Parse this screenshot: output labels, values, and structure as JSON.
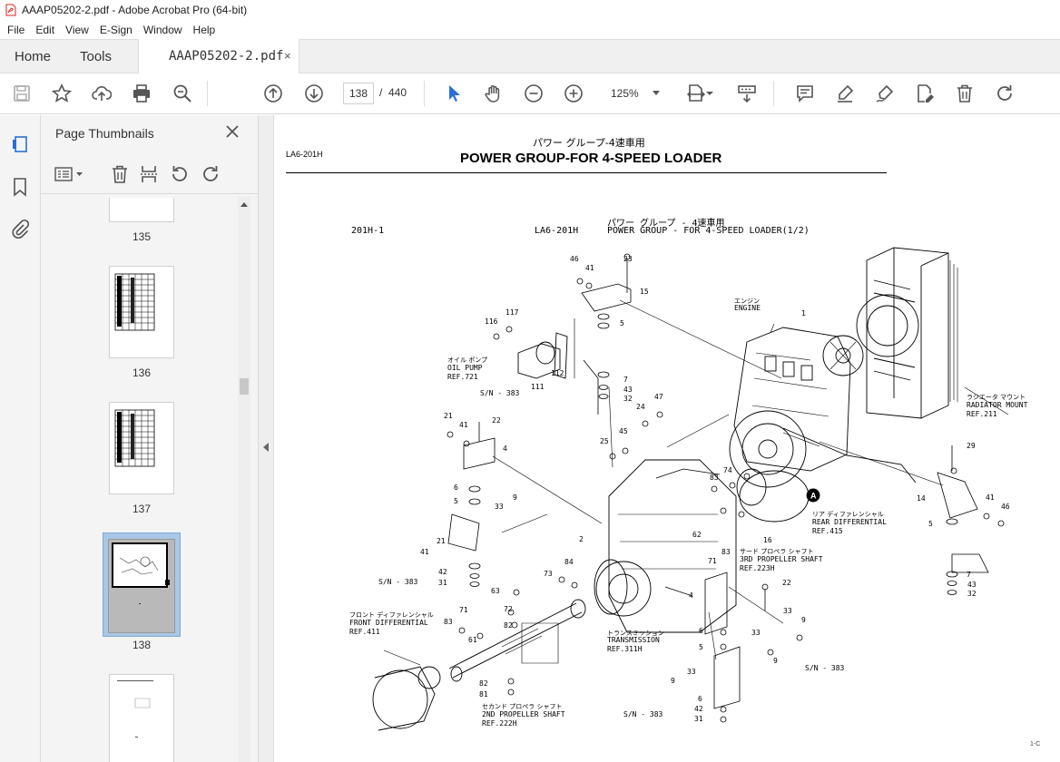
{
  "window": {
    "title": "AAAP05202-2.pdf - Adobe Acrobat Pro (64-bit)"
  },
  "menu": [
    "File",
    "Edit",
    "View",
    "E-Sign",
    "Window",
    "Help"
  ],
  "tabs": {
    "home": "Home",
    "tools": "Tools",
    "document": "AAAP05202-2.pdf",
    "close_glyph": "×"
  },
  "toolbar": {
    "current_page": "138",
    "page_separator": "/",
    "total_pages": "440",
    "zoom": "125%"
  },
  "thumbnails_panel": {
    "title": "Page Thumbnails",
    "pages": [
      {
        "label": "135"
      },
      {
        "label": "136"
      },
      {
        "label": "137"
      },
      {
        "label": "138",
        "selected": true
      }
    ]
  },
  "document": {
    "tag": "LA6-201H",
    "title_jp": "パワー グループ-4速車用",
    "title_en": "POWER GROUP-FOR 4-SPEED LOADER",
    "drawing_ref": "201H-1",
    "drawing_code": "LA6-201H",
    "drawing_title_jp": "パワー グループ - 4速車用",
    "drawing_title_en": "POWER GROUP - FOR 4-SPEED LOADER(1/2)",
    "footer": "1-C",
    "callouts": {
      "engine_jp": "エンジン",
      "engine_en": "ENGINE",
      "oil_pump_jp": "オイル ポンプ",
      "oil_pump_en": "OIL PUMP",
      "oil_pump_ref": "REF.721",
      "sn1": "S/N - 383",
      "sn2": "S/N - 383",
      "sn3": "S/N - 383",
      "sn4": "S/N - 383",
      "radiator_jp": "ラジエータ マウント",
      "radiator_en": "RADIATOR MOUNT",
      "radiator_ref": "REF.211",
      "rear_diff_jp": "リア ディファレンシャル",
      "rear_diff_en": "REAR DIFFERENTIAL",
      "rear_diff_ref": "REF.415",
      "third_shaft_jp": "サード プロペラ シャフト",
      "third_shaft_en": "3RD PROPELLER SHAFT",
      "third_shaft_ref": "REF.223H",
      "front_diff_jp": "フロント ディファレンシャル",
      "front_diff_en": "FRONT DIFFERENTIAL",
      "front_diff_ref": "REF.411",
      "transmission_jp": "トランスミッション",
      "transmission_en": "TRANSMISSION",
      "transmission_ref": "REF.311H",
      "second_shaft_jp": "セカンド プロペラ シャフト",
      "second_shaft_en": "2ND PROPELLER SHAFT",
      "second_shaft_ref": "REF.222H",
      "marker_a": "A"
    },
    "part_numbers": [
      "46",
      "41",
      "23",
      "15",
      "5",
      "117",
      "116",
      "112",
      "111",
      "7",
      "43",
      "32",
      "1",
      "24",
      "47",
      "21",
      "41",
      "22",
      "4",
      "45",
      "25",
      "6",
      "5",
      "33",
      "9",
      "84",
      "63",
      "72",
      "82",
      "74",
      "83",
      "2",
      "62",
      "71",
      "83",
      "16",
      "22",
      "14",
      "41",
      "46",
      "5",
      "7",
      "43",
      "32",
      "29",
      "73",
      "33",
      "9",
      "42",
      "31",
      "71",
      "83",
      "61",
      "82",
      "81",
      "4",
      "6",
      "5",
      "33",
      "9",
      "41",
      "21",
      "9",
      "33",
      "6",
      "42",
      "31",
      "63"
    ]
  }
}
